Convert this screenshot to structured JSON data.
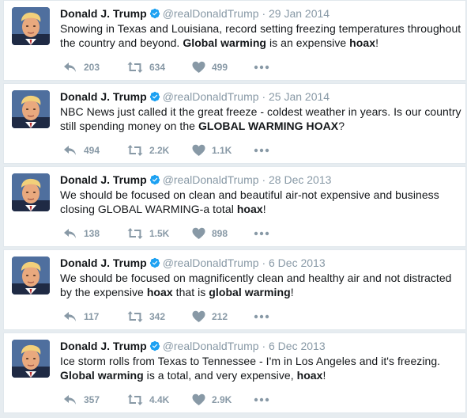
{
  "tweets": [
    {
      "name": "Donald J. Trump",
      "handle": "@realDonaldTrump",
      "separator": "·",
      "date": "29 Jan 2014",
      "segments": [
        {
          "t": "Snowing in Texas and Louisiana, record setting freezing temperatures throughout the country and beyond. ",
          "b": false
        },
        {
          "t": "Global warming",
          "b": true
        },
        {
          "t": " is an expensive ",
          "b": false
        },
        {
          "t": "hoax",
          "b": true
        },
        {
          "t": "!",
          "b": false
        }
      ],
      "replies": "203",
      "retweets": "634",
      "likes": "499"
    },
    {
      "name": "Donald J. Trump",
      "handle": "@realDonaldTrump",
      "separator": "·",
      "date": "25 Jan 2014",
      "segments": [
        {
          "t": "NBC News just called it the great freeze - coldest weather in years. Is our country still spending money on the ",
          "b": false
        },
        {
          "t": "GLOBAL WARMING HOAX",
          "b": true
        },
        {
          "t": "?",
          "b": false
        }
      ],
      "replies": "494",
      "retweets": "2.2K",
      "likes": "1.1K"
    },
    {
      "name": "Donald J. Trump",
      "handle": "@realDonaldTrump",
      "separator": "·",
      "date": "28 Dec 2013",
      "segments": [
        {
          "t": "We should be focused on clean and beautiful air-not expensive and business closing GLOBAL WARMING-a total ",
          "b": false
        },
        {
          "t": "hoax",
          "b": true
        },
        {
          "t": "!",
          "b": false
        }
      ],
      "replies": "138",
      "retweets": "1.5K",
      "likes": "898"
    },
    {
      "name": "Donald J. Trump",
      "handle": "@realDonaldTrump",
      "separator": "·",
      "date": "6 Dec 2013",
      "segments": [
        {
          "t": "We should be focused on magnificently clean and healthy air and not distracted by the expensive ",
          "b": false
        },
        {
          "t": "hoax",
          "b": true
        },
        {
          "t": " that is ",
          "b": false
        },
        {
          "t": "global warming",
          "b": true
        },
        {
          "t": "!",
          "b": false
        }
      ],
      "replies": "117",
      "retweets": "342",
      "likes": "212"
    },
    {
      "name": "Donald J. Trump",
      "handle": "@realDonaldTrump",
      "separator": "·",
      "date": "6 Dec 2013",
      "segments": [
        {
          "t": "Ice storm rolls from Texas to Tennessee - I'm in Los Angeles and it's freezing. ",
          "b": false
        },
        {
          "t": "Global warming",
          "b": true
        },
        {
          "t": " is a total, and very expensive, ",
          "b": false
        },
        {
          "t": "hoax",
          "b": true
        },
        {
          "t": "!",
          "b": false
        }
      ],
      "replies": "357",
      "retweets": "4.4K",
      "likes": "2.9K"
    }
  ],
  "icons": {
    "reply": "reply-icon",
    "retweet": "retweet-icon",
    "like": "heart-icon",
    "more": "more-icon",
    "verified": "verified-badge-icon"
  },
  "colors": {
    "text": "#14171a",
    "muted": "#8899a6",
    "icon": "#8899a6",
    "verified": "#1da1f2",
    "border": "#e1e8ed",
    "background": "#e6ecf0"
  }
}
